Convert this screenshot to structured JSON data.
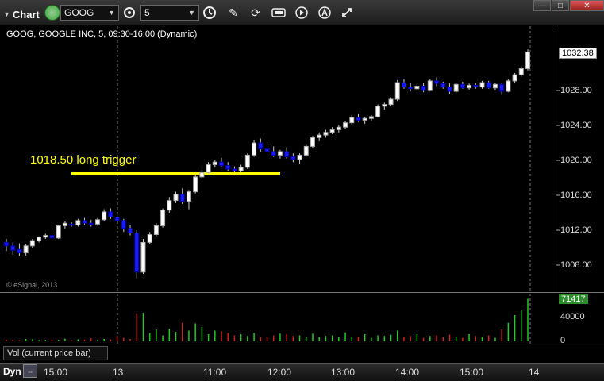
{
  "toolbar": {
    "app_label": "Chart",
    "symbol": "GOOG",
    "interval": "5",
    "icons": [
      "settings-icon",
      "clock-icon",
      "draw-pencil-icon",
      "refresh-cycle-icon",
      "quote-icon",
      "play-icon",
      "alert-icon",
      "link-icon"
    ]
  },
  "window": {
    "minimize": "—",
    "maximize": "□",
    "close": "✕"
  },
  "chart": {
    "title": "GOOG, GOOGLE INC, 5, 09:30-16:00 (Dynamic)",
    "copyright": "© eSignal, 2013",
    "annotation": "1018.50 long trigger",
    "trigger_price": 1018.5,
    "trigger_color": "#ffff00",
    "up_color": "#ffffff",
    "down_color": "#1a1aff"
  },
  "price_axis": {
    "ticks": [
      "1028.00",
      "1024.00",
      "1020.00",
      "1016.00",
      "1012.00",
      "1008.00"
    ],
    "last_price": "1032.38"
  },
  "volume": {
    "label": "Vol (current price bar)",
    "ticks": [
      "40000",
      "0"
    ],
    "last_value": "71417",
    "up_color": "#22cc22",
    "down_color": "#cc2222"
  },
  "time_axis": {
    "mode": "Dyn",
    "labels": [
      "15:00",
      "13",
      "11:00",
      "12:00",
      "13:00",
      "14:00",
      "15:00",
      "14"
    ]
  },
  "chart_data": {
    "type": "candlestick",
    "title": "GOOG, GOOGLE INC, 5, 09:30-16:00 (Dynamic)",
    "ylim": [
      1005,
      1034
    ],
    "annotations": [
      {
        "text": "1018.50 long trigger",
        "y": 1018.5
      }
    ],
    "ohlc": [
      [
        1010.6,
        1011.0,
        1009.6,
        1010.2
      ],
      [
        1010.2,
        1010.6,
        1009.2,
        1009.7
      ],
      [
        1009.8,
        1010.5,
        1009.0,
        1009.4
      ],
      [
        1009.4,
        1010.4,
        1009.1,
        1010.2
      ],
      [
        1010.2,
        1011.0,
        1010.0,
        1010.8
      ],
      [
        1010.8,
        1011.3,
        1010.6,
        1011.2
      ],
      [
        1011.2,
        1011.6,
        1011.0,
        1011.4
      ],
      [
        1011.4,
        1011.8,
        1011.0,
        1011.1
      ],
      [
        1011.1,
        1012.6,
        1011.0,
        1012.5
      ],
      [
        1012.5,
        1013.0,
        1012.2,
        1012.8
      ],
      [
        1012.7,
        1012.9,
        1012.4,
        1012.6
      ],
      [
        1012.6,
        1013.3,
        1012.4,
        1013.1
      ],
      [
        1013.1,
        1013.4,
        1012.6,
        1012.8
      ],
      [
        1012.8,
        1013.2,
        1012.4,
        1012.7
      ],
      [
        1012.7,
        1013.4,
        1012.5,
        1013.2
      ],
      [
        1013.2,
        1014.4,
        1013.0,
        1014.1
      ],
      [
        1014.1,
        1014.5,
        1013.3,
        1013.5
      ],
      [
        1013.5,
        1013.9,
        1012.8,
        1013.1
      ],
      [
        1013.1,
        1013.3,
        1011.8,
        1012.2
      ],
      [
        1012.2,
        1012.6,
        1011.4,
        1011.7
      ],
      [
        1011.7,
        1012.0,
        1006.5,
        1007.2
      ],
      [
        1007.2,
        1011.0,
        1007.0,
        1010.6
      ],
      [
        1010.6,
        1011.8,
        1010.4,
        1011.5
      ],
      [
        1011.5,
        1012.8,
        1011.3,
        1012.5
      ],
      [
        1012.5,
        1014.5,
        1012.3,
        1014.3
      ],
      [
        1014.3,
        1015.8,
        1014.0,
        1015.4
      ],
      [
        1015.4,
        1016.4,
        1015.1,
        1016.1
      ],
      [
        1016.1,
        1016.8,
        1015.0,
        1015.3
      ],
      [
        1015.3,
        1016.6,
        1014.4,
        1016.4
      ],
      [
        1016.4,
        1018.4,
        1016.2,
        1018.1
      ],
      [
        1018.1,
        1018.9,
        1017.8,
        1018.6
      ],
      [
        1018.6,
        1019.8,
        1018.4,
        1019.5
      ],
      [
        1019.5,
        1020.0,
        1019.2,
        1019.8
      ],
      [
        1019.8,
        1020.3,
        1019.3,
        1019.4
      ],
      [
        1019.4,
        1019.8,
        1018.8,
        1019.0
      ],
      [
        1019.0,
        1019.3,
        1018.6,
        1018.8
      ],
      [
        1018.8,
        1019.5,
        1018.6,
        1019.2
      ],
      [
        1019.2,
        1020.8,
        1019.0,
        1020.6
      ],
      [
        1020.6,
        1022.3,
        1020.4,
        1022.0
      ],
      [
        1022.0,
        1022.5,
        1021.0,
        1021.3
      ],
      [
        1021.3,
        1021.8,
        1020.6,
        1021.0
      ],
      [
        1021.0,
        1021.6,
        1020.4,
        1020.6
      ],
      [
        1020.6,
        1021.2,
        1020.2,
        1021.0
      ],
      [
        1021.0,
        1021.5,
        1020.2,
        1020.4
      ],
      [
        1020.4,
        1020.8,
        1019.8,
        1020.1
      ],
      [
        1020.1,
        1020.8,
        1019.6,
        1020.6
      ],
      [
        1020.6,
        1021.8,
        1020.4,
        1021.6
      ],
      [
        1021.6,
        1022.8,
        1021.4,
        1022.6
      ],
      [
        1022.6,
        1023.2,
        1022.2,
        1022.9
      ],
      [
        1022.9,
        1023.5,
        1022.6,
        1023.2
      ],
      [
        1023.2,
        1023.8,
        1023.0,
        1023.5
      ],
      [
        1023.5,
        1024.0,
        1023.2,
        1023.8
      ],
      [
        1023.8,
        1024.5,
        1023.6,
        1024.3
      ],
      [
        1024.3,
        1025.2,
        1024.0,
        1024.9
      ],
      [
        1024.9,
        1025.3,
        1024.4,
        1024.6
      ],
      [
        1024.6,
        1025.0,
        1024.2,
        1024.8
      ],
      [
        1024.8,
        1025.2,
        1024.5,
        1025.0
      ],
      [
        1025.0,
        1026.4,
        1024.9,
        1026.2
      ],
      [
        1026.2,
        1026.6,
        1025.8,
        1026.4
      ],
      [
        1026.4,
        1027.2,
        1026.2,
        1027.0
      ],
      [
        1027.0,
        1029.2,
        1026.8,
        1028.9
      ],
      [
        1028.9,
        1029.3,
        1028.2,
        1028.4
      ],
      [
        1028.4,
        1028.9,
        1027.9,
        1028.2
      ],
      [
        1028.2,
        1028.8,
        1027.9,
        1028.5
      ],
      [
        1028.5,
        1028.9,
        1027.8,
        1028.0
      ],
      [
        1028.0,
        1029.3,
        1027.9,
        1029.1
      ],
      [
        1029.1,
        1029.5,
        1028.5,
        1028.8
      ],
      [
        1028.8,
        1029.0,
        1028.2,
        1028.4
      ],
      [
        1028.4,
        1028.8,
        1027.6,
        1027.9
      ],
      [
        1027.9,
        1028.9,
        1027.7,
        1028.7
      ],
      [
        1028.7,
        1029.0,
        1028.2,
        1028.3
      ],
      [
        1028.3,
        1028.8,
        1028.1,
        1028.6
      ],
      [
        1028.6,
        1028.9,
        1028.2,
        1028.4
      ],
      [
        1028.4,
        1029.1,
        1028.2,
        1028.9
      ],
      [
        1028.9,
        1029.1,
        1028.2,
        1028.3
      ],
      [
        1028.3,
        1028.9,
        1028.0,
        1028.7
      ],
      [
        1028.7,
        1028.9,
        1027.5,
        1027.9
      ],
      [
        1027.9,
        1029.3,
        1027.8,
        1029.1
      ],
      [
        1029.1,
        1030.0,
        1028.9,
        1029.8
      ],
      [
        1029.8,
        1030.8,
        1029.6,
        1030.5
      ],
      [
        1030.5,
        1032.7,
        1030.3,
        1032.4
      ]
    ],
    "volume": [
      3000,
      2500,
      2000,
      4000,
      3500,
      2000,
      2500,
      3000,
      2500,
      4500,
      2000,
      3500,
      3000,
      5000,
      2500,
      4000,
      3500,
      9000,
      6000,
      4000,
      47000,
      48000,
      14000,
      20000,
      10000,
      21000,
      16000,
      31000,
      18000,
      30000,
      24000,
      12000,
      18000,
      17000,
      14000,
      10000,
      12000,
      9000,
      14000,
      7500,
      8000,
      10000,
      13000,
      12000,
      9000,
      10000,
      7000,
      13000,
      8000,
      9000,
      10000,
      7000,
      15000,
      8000,
      8000,
      12000,
      6000,
      10000,
      9000,
      11000,
      18000,
      8000,
      9000,
      12000,
      6000,
      9000,
      10000,
      8000,
      11000,
      7000,
      6000,
      12000,
      9000,
      8000,
      10000,
      6000,
      20000,
      31000,
      44000,
      52000,
      71417
    ]
  }
}
